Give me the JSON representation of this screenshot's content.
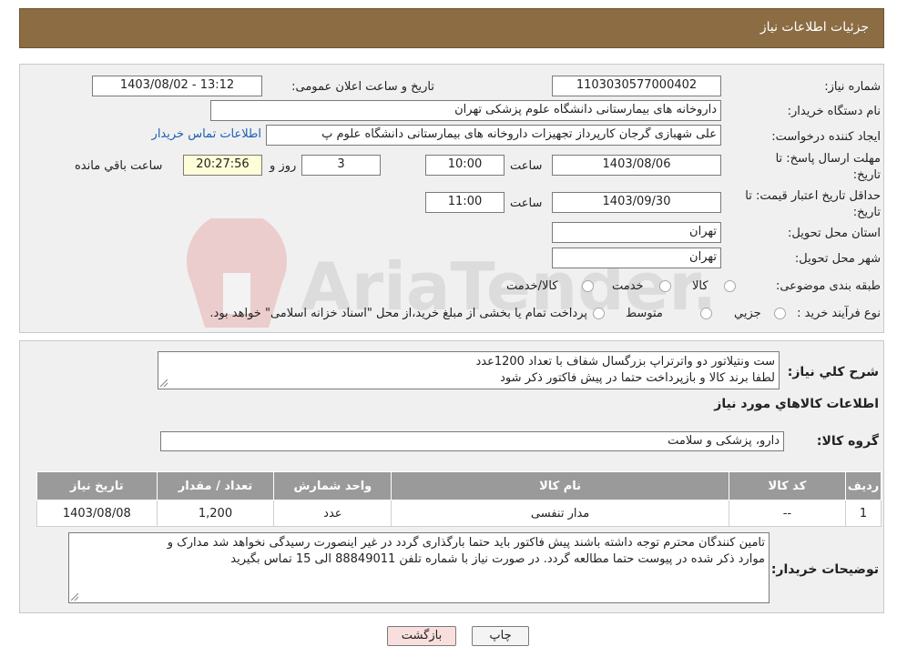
{
  "header": {
    "title": "جزئیات اطلاعات نیاز"
  },
  "watermark": {
    "text": "AriaTender.neT"
  },
  "form": {
    "need_number": {
      "label": "شماره نیاز:",
      "value": "1103030577000402"
    },
    "announce_datetime": {
      "label": "تاریخ و ساعت اعلان عمومی:",
      "value": "1403/08/02 - 13:12"
    },
    "buyer_org": {
      "label": "نام دستگاه خریدار:",
      "value": "داروخانه های بیمارستانی دانشگاه علوم پزشکی تهران"
    },
    "requester": {
      "label": "ایجاد کننده درخواست:",
      "value": "علی شهبازی گرجان کارپرداز تجهیزات داروخانه های بیمارستانی دانشگاه علوم پ",
      "contact_link": "اطلاعات تماس خریدار"
    },
    "deadline": {
      "label": "مهلت ارسال پاسخ: تا تاریخ:",
      "date": "1403/08/06",
      "time_label": "ساعت",
      "time": "10:00",
      "days": "3",
      "days_label": "روز و",
      "remaining": "20:27:56",
      "remaining_label": "ساعت باقي مانده"
    },
    "price_validity": {
      "label": "حداقل تاریخ اعتبار قیمت: تا تاریخ:",
      "date": "1403/09/30",
      "time_label": "ساعت",
      "time": "11:00"
    },
    "province": {
      "label": "استان محل تحویل:",
      "value": "تهران"
    },
    "city": {
      "label": "شهر محل تحویل:",
      "value": "تهران"
    },
    "category": {
      "label": "طبقه بندی موضوعی:",
      "options": [
        "کالا",
        "خدمت",
        "کالا/خدمت"
      ]
    },
    "purchase_type": {
      "label": "نوع فرآیند خرید :",
      "options": [
        "جزيي",
        "متوسط"
      ],
      "note": "پرداخت تمام يا بخشی از مبلغ خريد،از محل \"اسناد خزانه اسلامی\" خواهد بود."
    }
  },
  "description": {
    "label": "شرح كلي نياز:",
    "line1": "ست ونتیلاتور دو واترتراپ بزرگسال شفاف با تعداد 1200عدد",
    "line2": "لطفا برند کالا و بازپرداخت حتما در پیش فاکتور ذکر شود"
  },
  "goods_section": {
    "title": "اطلاعات كالاهاي مورد نياز"
  },
  "goods_group": {
    "label": "گروه کالا:",
    "value": "دارو، پزشکی و سلامت"
  },
  "goods_table": {
    "headers": [
      "رديف",
      "کد کالا",
      "نام کالا",
      "واحد شمارش",
      "تعداد / مقدار",
      "تاریخ نیاز"
    ],
    "rows": [
      [
        "1",
        "--",
        "مدار تنفسی",
        "عدد",
        "1,200",
        "1403/08/08"
      ]
    ]
  },
  "buyer_notes": {
    "label": "توضیحات خریدار:",
    "line1": "تامین کنندگان محترم توجه داشته باشند پیش فاکتور باید حتما بارگذاری گردد در غیر اینصورت رسیدگی نخواهد شد مدارک و",
    "line2": "موارد ذکر شده در پیوست حتما مطالعه گردد. در صورت نیاز با شماره تلفن 88849011 الی 15 تماس بگیرید"
  },
  "buttons": {
    "print": "چاپ",
    "back": "بازگشت"
  },
  "colors": {
    "header_bg": "#8b6c43",
    "link": "#1c5fb3",
    "back_btn_bg": "#f9dede"
  }
}
